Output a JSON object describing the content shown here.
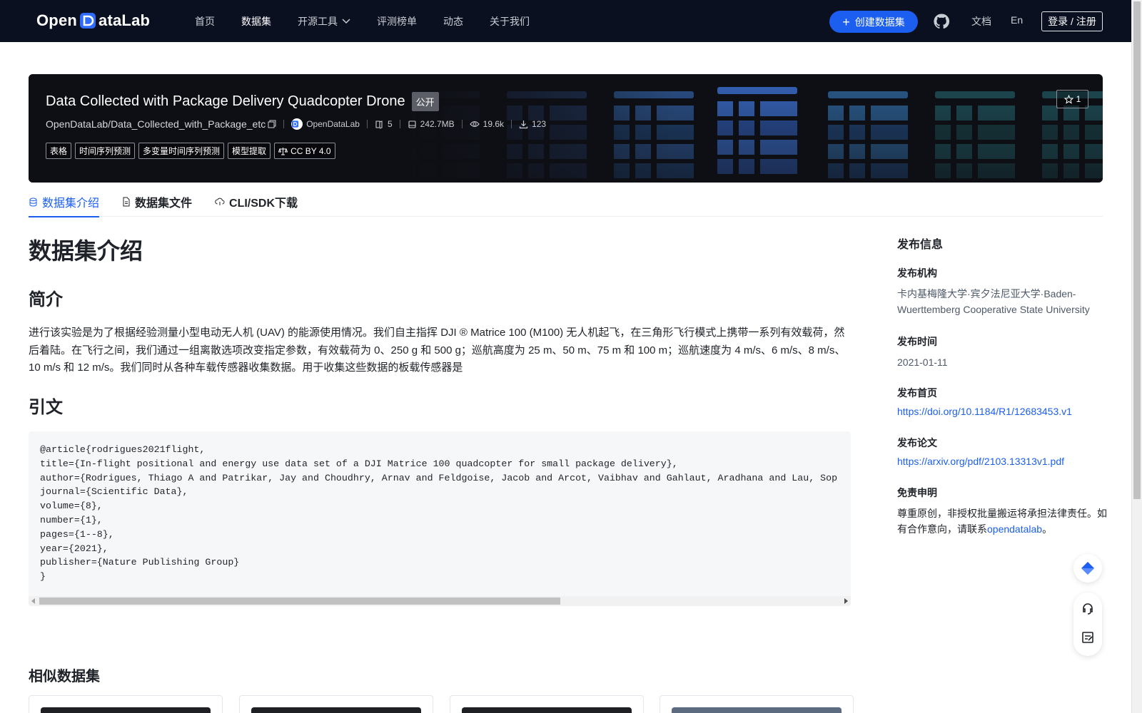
{
  "nav": {
    "logo_text_before": "Open",
    "logo_text_after": "ataLab",
    "links": [
      {
        "label": "首页"
      },
      {
        "label": "数据集"
      },
      {
        "label": "开源工具"
      },
      {
        "label": "评测榜单"
      },
      {
        "label": "动态"
      },
      {
        "label": "关于我们"
      }
    ],
    "create_label": "创建数据集",
    "docs_label": "文档",
    "lang_label": "En",
    "login_label": "登录 / 注册"
  },
  "banner": {
    "title": "Data Collected with Package Delivery Quadcopter Drone",
    "visibility": "公开",
    "repo": "OpenDataLab/Data_Collected_with_Package_etc",
    "org": "OpenDataLab",
    "files": "5",
    "size": "242.7MB",
    "views": "19.6k",
    "downloads": "123",
    "tags": [
      "表格",
      "时间序列预测",
      "多变量时间序列预测",
      "模型提取"
    ],
    "license": "CC BY 4.0",
    "stars": "1"
  },
  "tabs": [
    {
      "label": "数据集介绍"
    },
    {
      "label": "数据集文件"
    },
    {
      "label": "CLI/SDK下载"
    }
  ],
  "content": {
    "heading": "数据集介绍",
    "intro_heading": "简介",
    "intro_text": "进行该实验是为了根据经验测量小型电动无人机 (UAV) 的能源使用情况。我们自主指挥 DJI ® Matrice 100 (M100) 无人机起飞，在三角形飞行模式上携带一系列有效载荷，然后着陆。在飞行之间，我们通过一组离散选项改变指定参数，有效载荷为 0、250 g 和 500 g；巡航高度为 25 m、50 m、75 m 和 100 m；巡航速度为 4 m/s、6 m/s、8 m/s、10 m/s 和 12 m/s。我们同时从各种车载传感器收集数据。用于收集这些数据的板载传感器是",
    "citation_heading": "引文",
    "citation": "@article{rodrigues2021flight,\ntitle={In-flight positional and energy use data set of a DJI Matrice 100 quadcopter for small package delivery},\nauthor={Rodrigues, Thiago A and Patrikar, Jay and Choudhry, Arnav and Feldgoise, Jacob and Arcot, Vaibhav and Gahlaut, Aradhana and Lau, Sop\njournal={Scientific Data},\nvolume={8},\nnumber={1},\npages={1--8},\nyear={2021},\npublisher={Nature Publishing Group}\n}",
    "similar_heading": "相似数据集"
  },
  "sidebar": {
    "title": "发布信息",
    "org_label": "发布机构",
    "org_value": "卡内基梅隆大学·宾夕法尼亚大学·Baden-Wuerttemberg Cooperative State University",
    "date_label": "发布时间",
    "date_value": "2021-01-11",
    "home_label": "发布首页",
    "home_value": "https://doi.org/10.1184/R1/12683453.v1",
    "paper_label": "发布论文",
    "paper_value": "https://arxiv.org/pdf/2103.13313v1.pdf",
    "disclaimer_label": "免责申明",
    "disclaimer_text": "尊重原创，非授权批量搬运将承担法律责任。如有合作意向，请联系",
    "disclaimer_link": "opendatalab",
    "disclaimer_end": "。"
  },
  "colors": {
    "accent": "#1b5ef0",
    "nav_bg": "#0b1020",
    "banner_bg": "#0e0f14"
  }
}
